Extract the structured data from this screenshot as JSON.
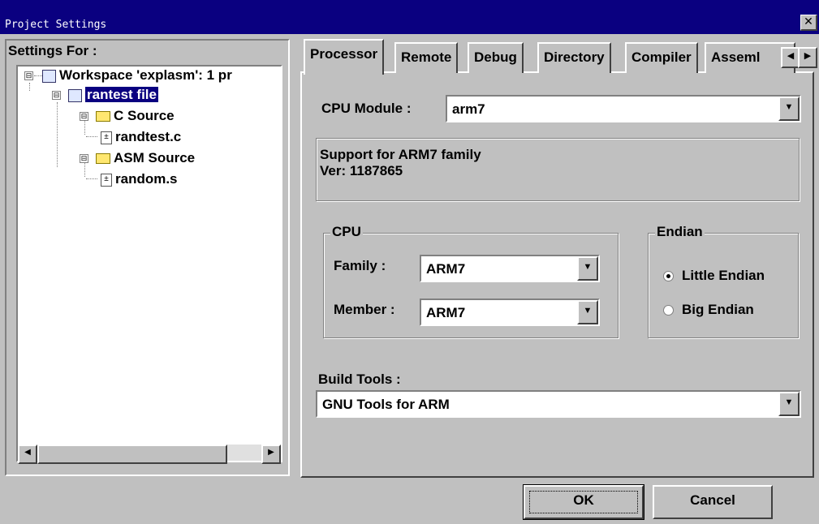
{
  "window": {
    "title": "Project Settings",
    "close_glyph": "✕"
  },
  "left": {
    "label": "Settings For :",
    "tree": [
      {
        "label": "Workspace 'explasm': 1 pr",
        "icon": "workspace-icon",
        "expander": "⊟"
      },
      {
        "label": "rantest file",
        "icon": "project-icon",
        "expander": "⊟",
        "selected": true
      },
      {
        "label": "C Source",
        "icon": "folder-icon",
        "expander": "⊟"
      },
      {
        "label": "randtest.c",
        "icon": "source-file-icon"
      },
      {
        "label": "ASM Source",
        "icon": "folder-icon",
        "expander": "⊟"
      },
      {
        "label": "random.s",
        "icon": "source-file-icon"
      }
    ],
    "scroll_left": "◀",
    "scroll_right": "▶"
  },
  "tabs": [
    {
      "label": "Processor",
      "active": true
    },
    {
      "label": "Remote"
    },
    {
      "label": "Debug"
    },
    {
      "label": "Directory"
    },
    {
      "label": "Compiler"
    },
    {
      "label": "Asseml"
    }
  ],
  "tab_scroll": {
    "left": "◀",
    "right": "▶"
  },
  "processor": {
    "cpu_module_label": "CPU Module :",
    "cpu_module_value": "arm7",
    "info_line1": "Support for ARM7 family",
    "info_line2": "Ver: 1187865",
    "cpu_group": "CPU",
    "family_label": "Family :",
    "family_value": "ARM7",
    "member_label": "Member :",
    "member_value": "ARM7",
    "endian_group": "Endian",
    "little_endian": "Little Endian",
    "big_endian": "Big Endian",
    "endian_selected": "little",
    "build_tools_label": "Build Tools :",
    "build_tools_value": "GNU Tools for ARM",
    "dropdown_glyph": "▼"
  },
  "buttons": {
    "ok": "OK",
    "cancel": "Cancel"
  }
}
